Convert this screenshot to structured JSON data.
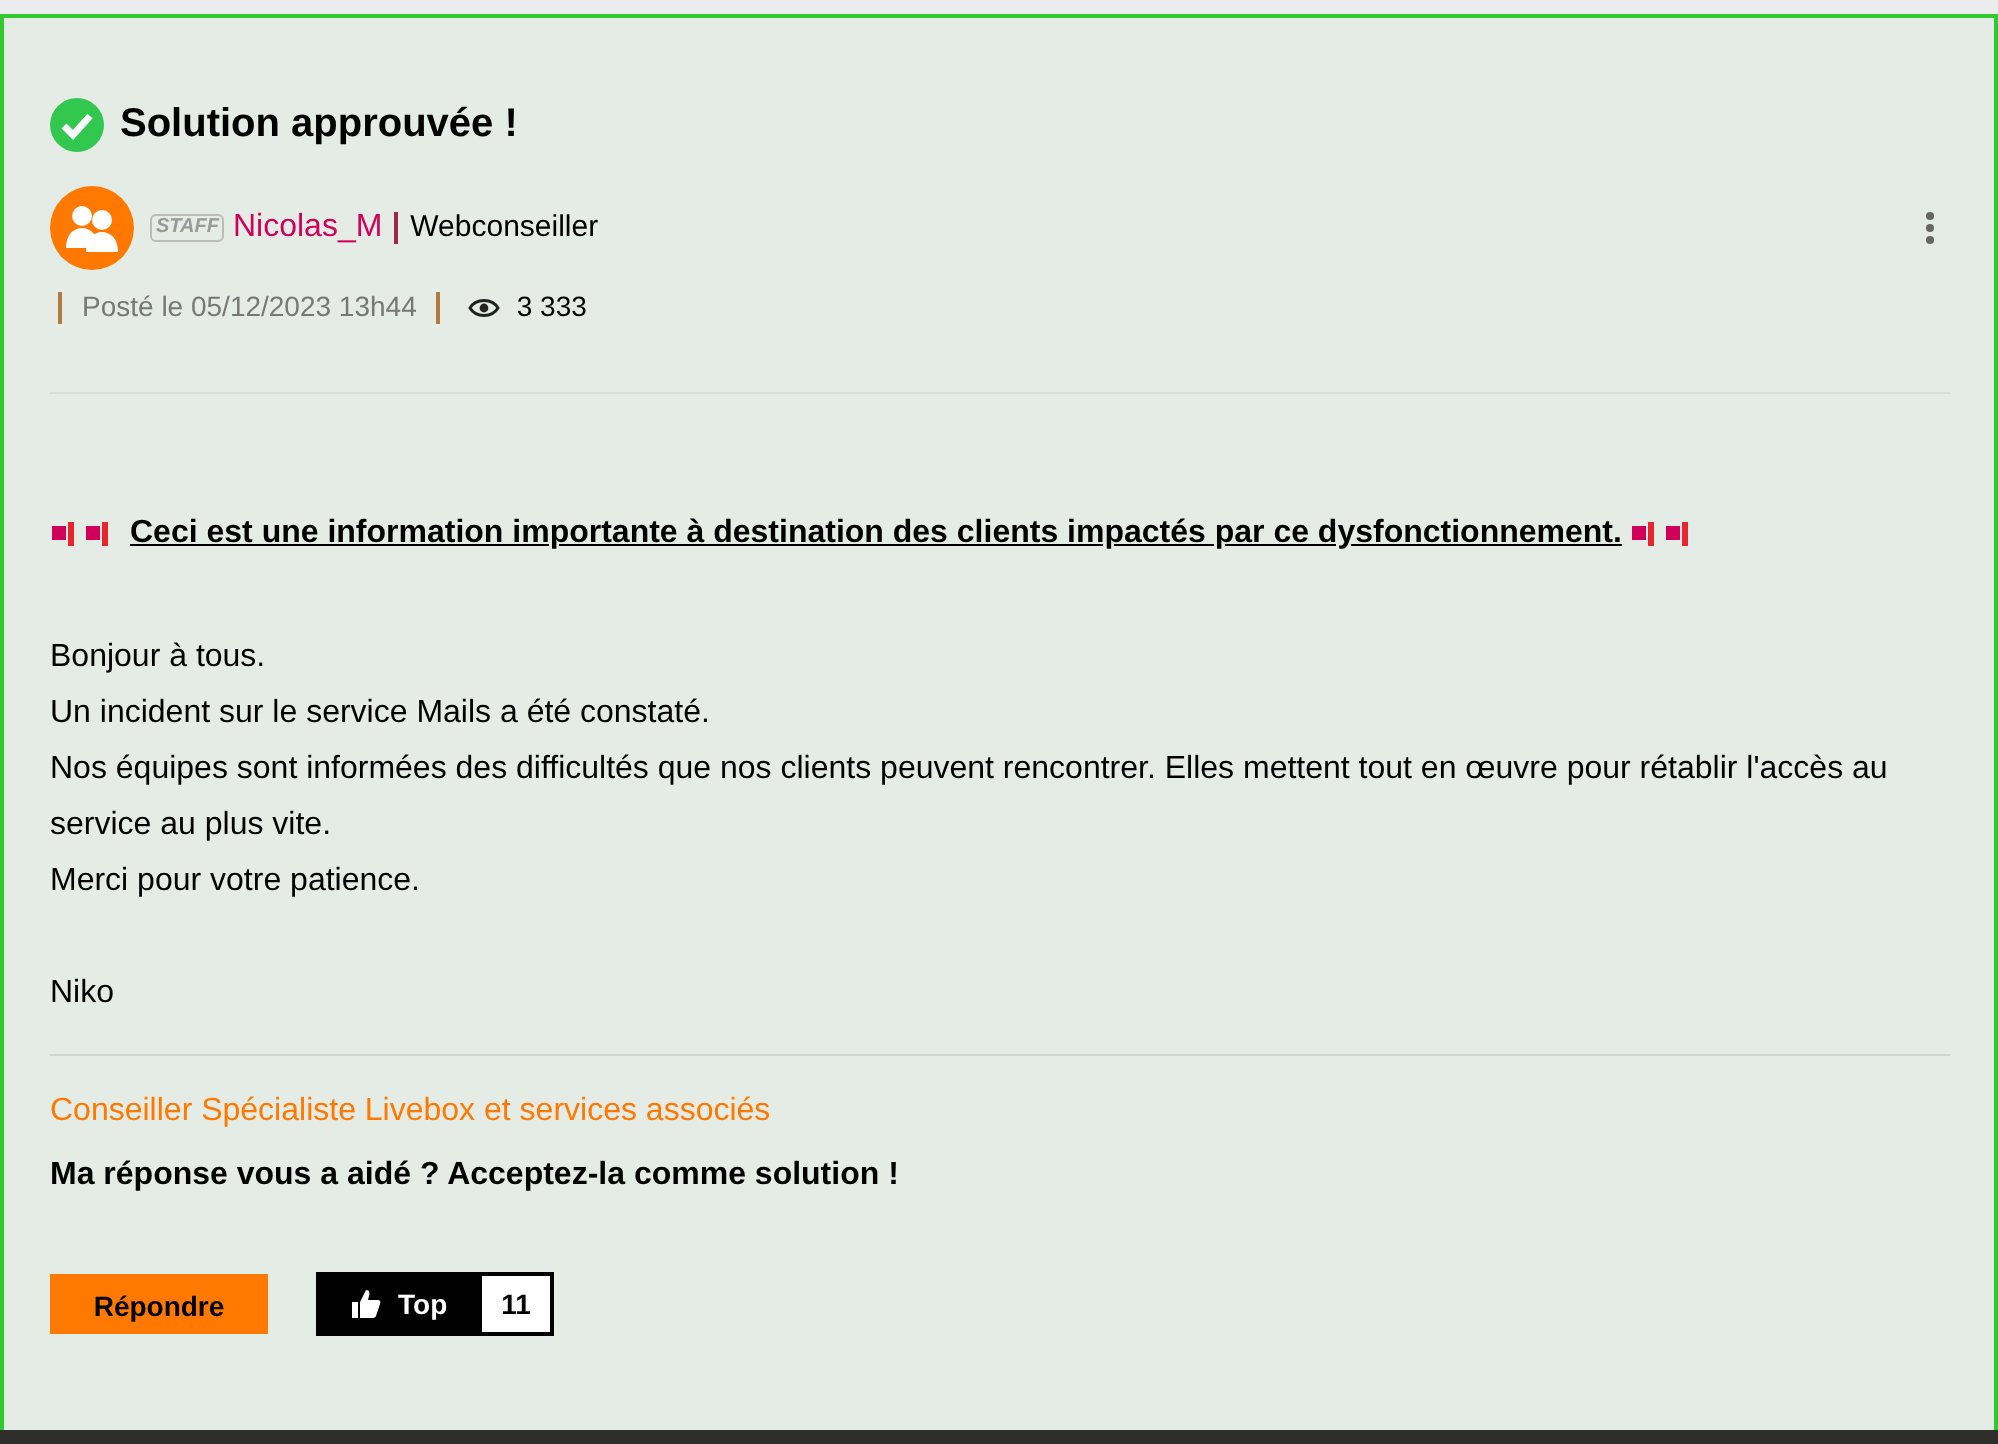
{
  "post": {
    "status_title": "Solution approuvée !",
    "author": {
      "badge": "STAFF",
      "name": "Nicolas_M",
      "role": "Webconseiller"
    },
    "posted": "Posté le 05/12/2023 13h44",
    "views": "3 333",
    "headline": "Ceci est une information importante à destination des clients impactés par ce dysfonctionnement.",
    "body": [
      "Bonjour à tous.",
      "Un incident sur le service Mails a été constaté.",
      "Nos équipes sont informées des difficultés que nos clients peuvent rencontrer. Elles mettent tout en œuvre pour rétablir l'accès au service au plus vite.",
      "Merci pour votre patience."
    ],
    "signoff": "Niko",
    "signature_title": "Conseiller Spécialiste Livebox et services associés",
    "signature_text": "Ma réponse vous a aidé ? Acceptez-la comme solution !",
    "reply_button": "Répondre",
    "top_button": "Top",
    "top_count": "11"
  }
}
